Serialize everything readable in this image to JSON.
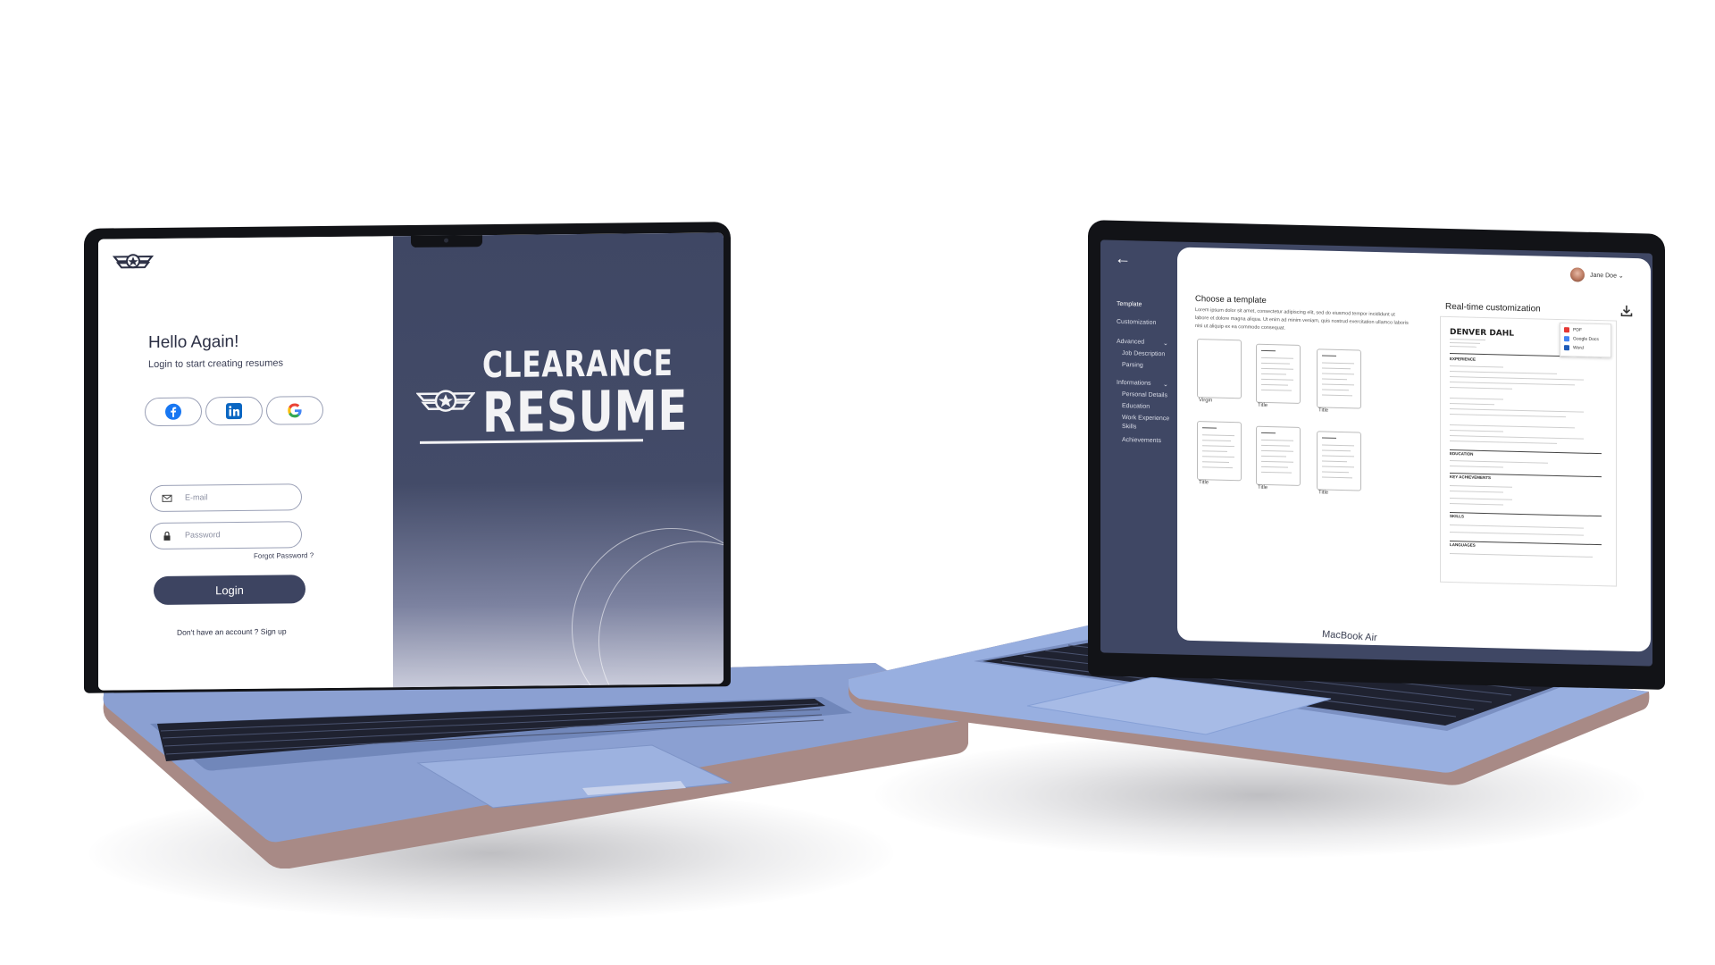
{
  "login_screen": {
    "greeting": "Hello Again!",
    "subtitle": "Login to start creating resumes",
    "social": [
      {
        "name": "facebook",
        "icon": "facebook-icon",
        "color": "#1877f2"
      },
      {
        "name": "linkedin",
        "icon": "linkedin-icon",
        "color": "#0a66c2"
      },
      {
        "name": "google",
        "icon": "google-icon",
        "color": "#4285f4"
      }
    ],
    "email_placeholder": "E-mail",
    "password_placeholder": "Password",
    "forgot_password": "Forgot Password ?",
    "login_button": "Login",
    "signup_prompt": "Don't have an account ? Sign up"
  },
  "brand": {
    "line1": "CLEARANCE",
    "line2": "RESUME"
  },
  "editor_screen": {
    "sidebar": [
      {
        "label": "Template"
      },
      {
        "label": "Customization"
      },
      {
        "label": "Advanced",
        "children": [
          "Job Description",
          "Parsing"
        ]
      },
      {
        "label": "Informations",
        "children": [
          "Personal Details",
          "Education",
          "Work Experience",
          "Skills",
          "Achievements"
        ]
      }
    ],
    "user_name": "Jane Doe",
    "choose_template_title": "Choose a template",
    "choose_template_text": "Lorem ipsum dolor sit amet, consectetur adipiscing elit, sed do eiusmod tempor incididunt ut labore et dolore magna aliqua. Ut enim ad minim veniam, quis nostrud exercitation ullamco laboris nisi ut aliquip ex ea commodo consequat.",
    "templates": [
      "Virgin",
      "Title",
      "Title",
      "Title",
      "Title",
      "Title"
    ],
    "realtime_title": "Real-time customization",
    "export_options": [
      "PDF",
      "Google Docs",
      "Word"
    ],
    "resume_preview": {
      "name": "DENVER DAHL",
      "sections": [
        "EXPERIENCE",
        "EDUCATION",
        "KEY ACHIEVEMENTS",
        "SKILLS",
        "LANGUAGES"
      ]
    }
  },
  "device_label": "MacBook Air",
  "colors": {
    "navy": "#3f4764",
    "button": "#3d4461",
    "laptop_body": "#8ea5d6",
    "bezel": "#121317"
  }
}
